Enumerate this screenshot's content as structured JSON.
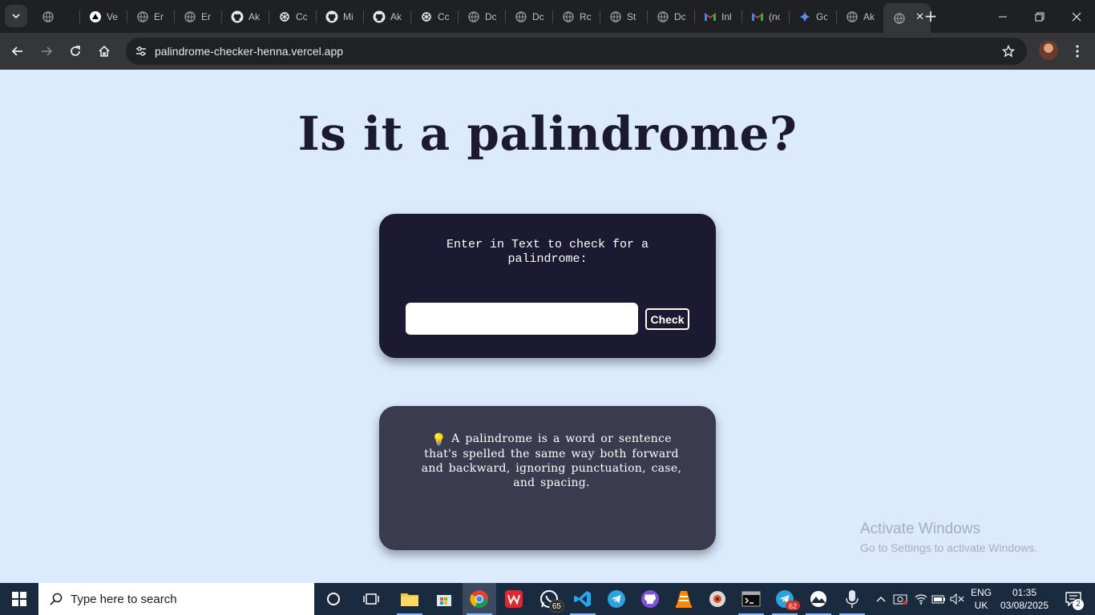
{
  "browser": {
    "tabs": [
      {
        "title": "",
        "icon": "globe-icon"
      },
      {
        "title": "Ve",
        "icon": "vercel-icon"
      },
      {
        "title": "Er",
        "icon": "globe-icon"
      },
      {
        "title": "Er",
        "icon": "globe-icon"
      },
      {
        "title": "Ak",
        "icon": "github-icon"
      },
      {
        "title": "Cc",
        "icon": "openai-icon"
      },
      {
        "title": "Mi",
        "icon": "github-icon"
      },
      {
        "title": "Ak",
        "icon": "github-icon"
      },
      {
        "title": "Cc",
        "icon": "openai-icon"
      },
      {
        "title": "Dc",
        "icon": "globe-icon"
      },
      {
        "title": "Dc",
        "icon": "globe-icon"
      },
      {
        "title": "Rc",
        "icon": "globe-icon"
      },
      {
        "title": "St",
        "icon": "globe-icon"
      },
      {
        "title": "Dc",
        "icon": "globe-icon"
      },
      {
        "title": "Inl",
        "icon": "gmail-icon"
      },
      {
        "title": "(nc",
        "icon": "gmail-icon"
      },
      {
        "title": "Gc",
        "icon": "gemini-icon"
      },
      {
        "title": "Ak",
        "icon": "globe-icon"
      },
      {
        "title": "",
        "icon": "globe-icon",
        "active": true
      }
    ],
    "url": "palindrome-checker-henna.vercel.app"
  },
  "page": {
    "title": "Is it a palindrome?",
    "checker": {
      "label": "Enter in Text to check for a palindrome:",
      "input_value": "",
      "input_placeholder": "",
      "button_label": "Check"
    },
    "info": {
      "bulb": "💡",
      "text": "A palindrome is a word or sentence that's spelled the same way both forward and backward, ignoring punctuation, case, and spacing."
    },
    "watermark": {
      "line1": "Activate Windows",
      "line2": "Go to Settings to activate Windows."
    }
  },
  "taskbar": {
    "search_placeholder": "Type here to search",
    "whatsapp_badge": "65",
    "telegram_badge": "62",
    "language": {
      "line1": "ENG",
      "line2": "UK"
    },
    "clock": {
      "time": "01:35",
      "date": "03/08/2025"
    },
    "notifications_count": "2"
  },
  "colors": {
    "page_background": "#dbeafd",
    "title_color": "#1c1a33",
    "checker_card": "#1c1a33",
    "info_card": "#3b3b4f"
  }
}
